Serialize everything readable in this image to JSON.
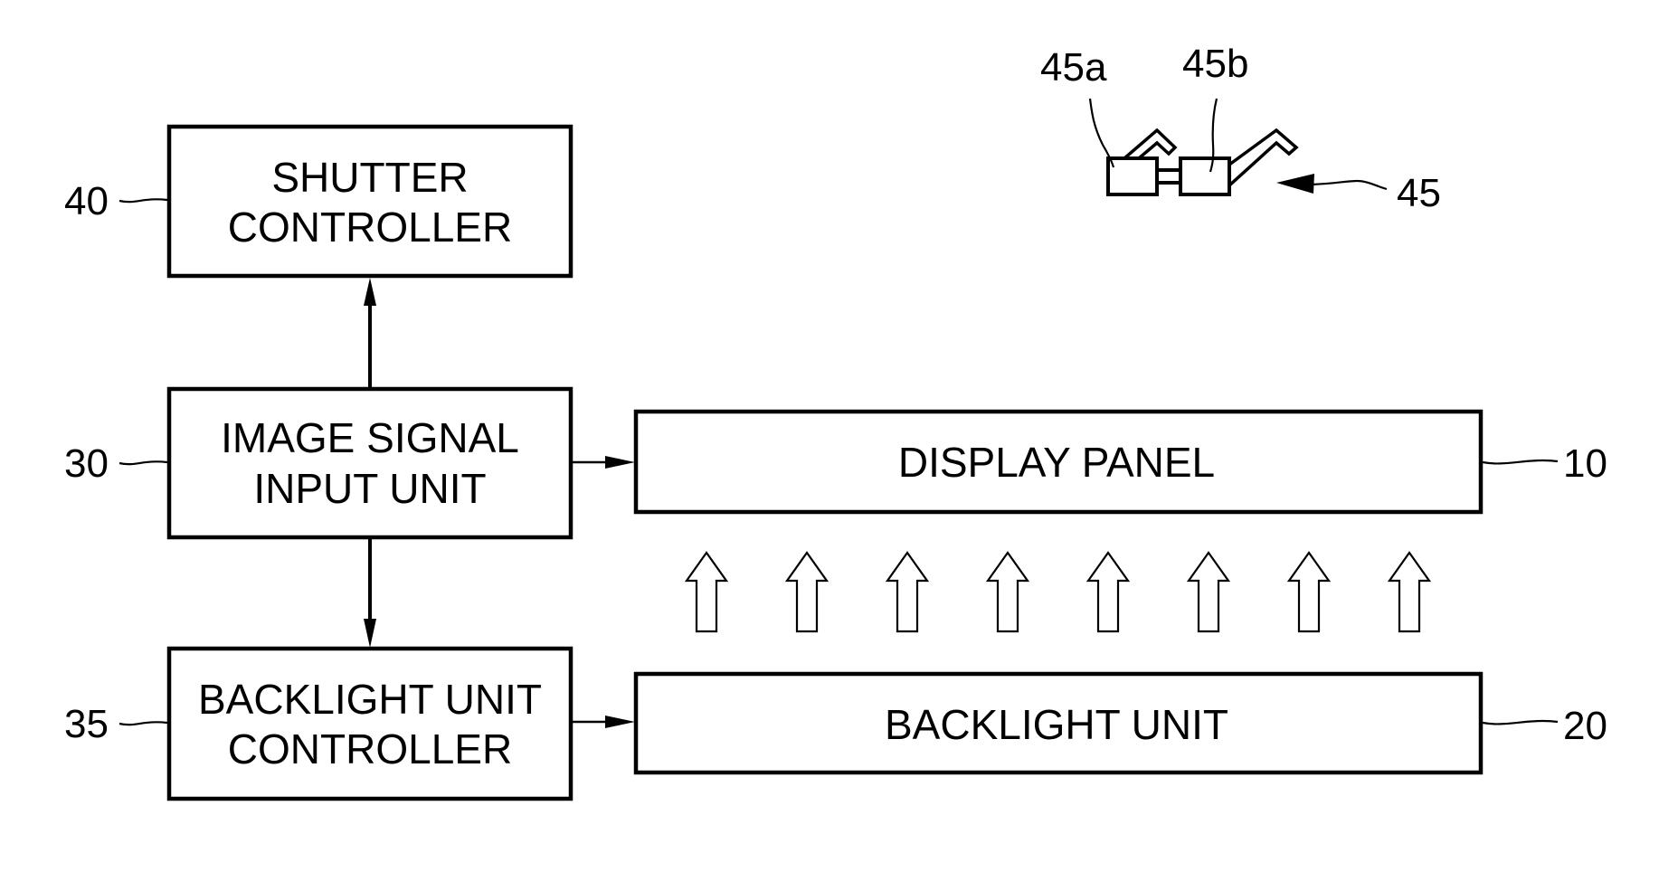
{
  "figure": {
    "blocks": {
      "shutter_controller": {
        "ref": "40",
        "lines": [
          "SHUTTER",
          "CONTROLLER"
        ]
      },
      "image_signal_input_unit": {
        "ref": "30",
        "lines": [
          "IMAGE SIGNAL",
          "INPUT UNIT"
        ]
      },
      "backlight_unit_controller": {
        "ref": "35",
        "lines": [
          "BACKLIGHT UNIT",
          "CONTROLLER"
        ]
      },
      "display_panel": {
        "ref": "10",
        "label": "DISPLAY PANEL"
      },
      "backlight_unit": {
        "ref": "20",
        "label": "BACKLIGHT UNIT"
      }
    },
    "glasses": {
      "ref": "45",
      "left_shutter_ref": "45a",
      "right_shutter_ref": "45b"
    },
    "light_arrows": {
      "count": 8,
      "direction": "up",
      "from": "backlight_unit",
      "to": "display_panel"
    },
    "connections": [
      {
        "from": "image_signal_input_unit",
        "to": "shutter_controller"
      },
      {
        "from": "image_signal_input_unit",
        "to": "backlight_unit_controller"
      },
      {
        "from": "image_signal_input_unit",
        "to": "display_panel"
      },
      {
        "from": "backlight_unit_controller",
        "to": "backlight_unit"
      }
    ]
  }
}
